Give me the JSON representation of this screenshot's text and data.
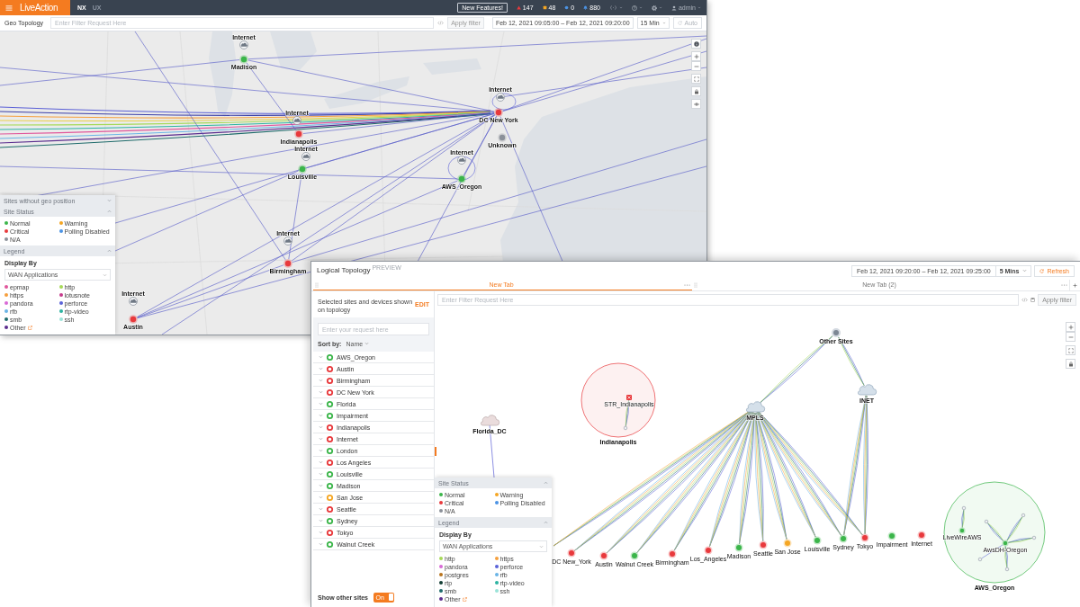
{
  "geo_window": {
    "app_bar": {
      "logo": "LiveAction",
      "nav": [
        {
          "label": "NX",
          "selected": true
        },
        {
          "label": "UX",
          "selected": false
        }
      ],
      "new_features": "New Features!",
      "counters": [
        {
          "kind": "critical",
          "count": "147"
        },
        {
          "kind": "warning",
          "count": "48"
        },
        {
          "kind": "info",
          "count": "0"
        },
        {
          "kind": "notification",
          "count": "880"
        }
      ],
      "menus": [
        {
          "kind": "code"
        },
        {
          "kind": "help"
        },
        {
          "kind": "settings"
        },
        {
          "kind": "user",
          "label": "admin"
        }
      ]
    },
    "toolbar": {
      "title": "Geo Topology",
      "filter_placeholder": "Enter Filter Request Here",
      "apply": "Apply filter",
      "time_range": "Feb 12, 2021 09:05:00 – Feb 12, 2021 09:20:00",
      "interval": "15 Min",
      "auto": {
        "label": "Auto",
        "disabled": true
      }
    },
    "map_nodes": [
      {
        "kind": "cloud",
        "label": "Internet"
      },
      {
        "kind": "site",
        "label": "Madison",
        "color": "#3bb54a"
      },
      {
        "kind": "site",
        "label": "DC New York",
        "color": "#e8393c"
      },
      {
        "kind": "site",
        "label": "Unknown",
        "color": "#8b9099"
      },
      {
        "kind": "cloud",
        "label": "Internet"
      },
      {
        "kind": "site",
        "label": "Indianapolis",
        "color": "#e8393c"
      },
      {
        "kind": "cloud",
        "label": "Internet"
      },
      {
        "kind": "site",
        "label": "Louisville",
        "color": "#3bb54a"
      },
      {
        "kind": "cloud",
        "label": "Internet"
      },
      {
        "kind": "site",
        "label": "AWS_Oregon",
        "color": "#3bb54a"
      },
      {
        "kind": "cloud",
        "label": "Internet"
      },
      {
        "kind": "site",
        "label": "Birmingham",
        "color": "#e8393c"
      },
      {
        "kind": "cloud",
        "label": "Internet"
      },
      {
        "kind": "site",
        "label": "Austin",
        "color": "#e8393c"
      },
      {
        "kind": "cloud",
        "label": "Internet"
      }
    ],
    "panel": {
      "sections": [
        {
          "title": "Sites without geo position",
          "expanded": false
        },
        {
          "kind": "status",
          "title": "Site Status",
          "expanded": true,
          "items": [
            {
              "label": "Normal",
              "color": "#3bb54a"
            },
            {
              "label": "Warning",
              "color": "#f5a623"
            },
            {
              "label": "Critical",
              "color": "#e8393c"
            },
            {
              "label": "Polling Disabled",
              "color": "#4b93e4"
            },
            {
              "label": "N/A",
              "color": "#8b9099"
            }
          ]
        },
        {
          "kind": "legend",
          "title": "Legend",
          "expanded": true,
          "display_by": "Display By",
          "dropdown": "WAN Applications",
          "items": [
            {
              "kind": "app",
              "label": "epmap",
              "color": "#e0569b"
            },
            {
              "kind": "app",
              "label": "http",
              "color": "#a6d957"
            },
            {
              "kind": "app",
              "label": "https",
              "color": "#f59f3d"
            },
            {
              "kind": "app",
              "label": "lotusnote",
              "color": "#c63a8c"
            },
            {
              "kind": "app",
              "label": "pandora",
              "color": "#d86ad6"
            },
            {
              "kind": "app",
              "label": "perforce",
              "color": "#5a63d8"
            },
            {
              "kind": "app",
              "label": "rfb",
              "color": "#6ab4e6"
            },
            {
              "kind": "app",
              "label": "rtp-video",
              "color": "#2bb3a1"
            },
            {
              "kind": "app",
              "label": "smb",
              "color": "#1d6a6a"
            },
            {
              "kind": "app",
              "label": "ssh",
              "color": "#9be3d9"
            },
            {
              "kind": "link",
              "label": "Other",
              "color": "#5b2d8e"
            }
          ]
        }
      ]
    }
  },
  "logical_window": {
    "title": "Logical Topology",
    "badge": "PREVIEW",
    "time_range": "Feb 12, 2021 09:20:00 – Feb 12, 2021 09:25:00",
    "interval": "5 Mins",
    "refresh": "Refresh",
    "tabs": [
      {
        "label": "New Tab",
        "selected": true
      },
      {
        "label": "New Tab (2)",
        "selected": false
      }
    ],
    "filter_placeholder": "Enter Filter Request Here",
    "apply": "Apply filter",
    "sites_panel": {
      "heading": "Selected sites and devices shown on topology",
      "edit": "EDIT",
      "search_placeholder": "Enter your request here",
      "sort_label": "Sort by:",
      "sort_value": "Name",
      "sites": [
        {
          "name": "AWS_Oregon",
          "color": "#3bb54a"
        },
        {
          "name": "Austin",
          "color": "#e8393c"
        },
        {
          "name": "Birmingham",
          "color": "#e8393c"
        },
        {
          "name": "DC New York",
          "color": "#e8393c"
        },
        {
          "name": "Florida",
          "color": "#3bb54a"
        },
        {
          "name": "Impairment",
          "color": "#3bb54a"
        },
        {
          "name": "Indianapolis",
          "color": "#e8393c"
        },
        {
          "name": "Internet",
          "color": "#e8393c"
        },
        {
          "name": "London",
          "color": "#3bb54a"
        },
        {
          "name": "Los Angeles",
          "color": "#e8393c"
        },
        {
          "name": "Louisville",
          "color": "#3bb54a"
        },
        {
          "name": "Madison",
          "color": "#3bb54a"
        },
        {
          "name": "San Jose",
          "color": "#f5a623"
        },
        {
          "name": "Seattle",
          "color": "#e8393c"
        },
        {
          "name": "Sydney",
          "color": "#3bb54a"
        },
        {
          "name": "Tokyo",
          "color": "#e8393c"
        },
        {
          "name": "Walnut Creek",
          "color": "#3bb54a"
        }
      ],
      "show_other": {
        "label": "Show other sites",
        "toggle_text": "On",
        "on": true
      }
    },
    "legend": {
      "sections": [
        {
          "kind": "status",
          "title": "Site Status",
          "expanded": true,
          "items": [
            {
              "label": "Normal",
              "color": "#3bb54a"
            },
            {
              "label": "Warning",
              "color": "#f5a623"
            },
            {
              "label": "Critical",
              "color": "#e8393c"
            },
            {
              "label": "Polling Disabled",
              "color": "#4b93e4"
            },
            {
              "label": "N/A",
              "color": "#8b9099"
            }
          ]
        },
        {
          "kind": "legend",
          "title": "Legend",
          "expanded": true,
          "display_by": "Display By",
          "dropdown": "WAN Applications",
          "items": [
            {
              "kind": "app",
              "label": "http",
              "color": "#a6d957"
            },
            {
              "kind": "app",
              "label": "https",
              "color": "#f59f3d"
            },
            {
              "kind": "app",
              "label": "pandora",
              "color": "#d86ad6"
            },
            {
              "kind": "app",
              "label": "perforce",
              "color": "#5a63d8"
            },
            {
              "kind": "app",
              "label": "postgres",
              "color": "#b8741e"
            },
            {
              "kind": "app",
              "label": "rfb",
              "color": "#6ab4e6"
            },
            {
              "kind": "app",
              "label": "rtp",
              "color": "#123d33"
            },
            {
              "kind": "app",
              "label": "rtp-video",
              "color": "#2bb3a1"
            },
            {
              "kind": "app",
              "label": "smb",
              "color": "#1d6a6a"
            },
            {
              "kind": "app",
              "label": "ssh",
              "color": "#9be3d9"
            },
            {
              "kind": "link",
              "label": "Other",
              "color": "#5b2d8e"
            }
          ]
        }
      ]
    },
    "topology": {
      "hubs": [
        {
          "kind": "other",
          "label": "Other Sites"
        },
        {
          "kind": "cloud",
          "label": "MPLS"
        },
        {
          "kind": "cloud",
          "label": "INET"
        },
        {
          "kind": "alertcloud",
          "label": "Florida_DC"
        }
      ],
      "site_groups": [
        {
          "label": "Indianapolis",
          "color": "#e8393c",
          "devices": [
            {
              "kind": "router",
              "label": "STR_Indianapolis"
            }
          ]
        },
        {
          "label": "AWS_Oregon",
          "color": "#3bb54a",
          "devices": [
            {
              "kind": "server",
              "label": "LiveWireAWS"
            },
            {
              "kind": "server",
              "label": "AwsDH-Oregon"
            }
          ]
        }
      ],
      "sites": [
        {
          "label": "DC New_York",
          "color": "#e8393c"
        },
        {
          "label": "Austin",
          "color": "#e8393c"
        },
        {
          "label": "Walnut Creek",
          "color": "#3bb54a"
        },
        {
          "label": "Birmingham",
          "color": "#e8393c"
        },
        {
          "label": "Los_Angeles",
          "color": "#e8393c"
        },
        {
          "label": "Madison",
          "color": "#3bb54a"
        },
        {
          "label": "Seattle",
          "color": "#e8393c"
        },
        {
          "label": "San Jose",
          "color": "#f5a623"
        },
        {
          "label": "Louisville",
          "color": "#3bb54a"
        },
        {
          "label": "Sydney",
          "color": "#3bb54a"
        },
        {
          "label": "Tokyo",
          "color": "#e8393c"
        },
        {
          "label": "Impairment",
          "color": "#3bb54a"
        },
        {
          "label": "Internet",
          "color": "#e8393c"
        }
      ]
    }
  }
}
